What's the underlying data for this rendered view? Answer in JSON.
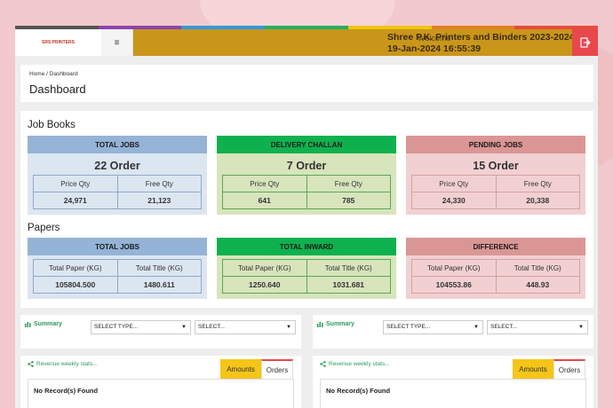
{
  "topbar": {
    "logo_text": "SRS PRINTERS",
    "menu_icon": "hamburger-icon",
    "welcome": "Welcome",
    "company": "Shree P.K. Printers and Binders 2023-2024",
    "datetime": "19-Jan-2024 16:55:39",
    "logout_icon": "logout-icon",
    "color_strip": [
      "#555555",
      "#8e44ad",
      "#3498db",
      "#27ae60",
      "#f1c40f",
      "#e67e22",
      "#e74c3c"
    ]
  },
  "breadcrumb": "Home / Dashboard",
  "page_title": "Dashboard",
  "job_books": {
    "title": "Job Books",
    "cards": [
      {
        "header": "TOTAL JOBS",
        "order": "22 Order",
        "col1": "Price Qty",
        "col2": "Free Qty",
        "val1": "24,971",
        "val2": "21,123"
      },
      {
        "header": "DELIVERY CHALLAN",
        "order": "7 Order",
        "col1": "Price Qty",
        "col2": "Free Qty",
        "val1": "641",
        "val2": "785"
      },
      {
        "header": "PENDING JOBS",
        "order": "15 Order",
        "col1": "Price Qty",
        "col2": "Free Qty",
        "val1": "24,330",
        "val2": "20,338"
      }
    ]
  },
  "papers": {
    "title": "Papers",
    "cards": [
      {
        "header": "TOTAL JOBS",
        "col1": "Total Paper (KG)",
        "col2": "Total Title (KG)",
        "val1": "105804.500",
        "val2": "1480.611"
      },
      {
        "header": "TOTAL INWARD",
        "col1": "Total Paper (KG)",
        "col2": "Total Title (KG)",
        "val1": "1250.640",
        "val2": "1031.681"
      },
      {
        "header": "DIFFERENCE",
        "col1": "Total Paper (KG)",
        "col2": "Total Title (KG)",
        "val1": "104553.86",
        "val2": "448.93"
      }
    ]
  },
  "summary": [
    {
      "label": "Summary",
      "icon": "bar-chart-icon",
      "select_type": "SELECT TYPE...",
      "select_other": "SELECT..."
    },
    {
      "label": "Summary",
      "icon": "bar-chart-icon",
      "select_type": "SELECT TYPE...",
      "select_other": "SELECT..."
    }
  ],
  "revenue": [
    {
      "label": "Revenue weekly stats...",
      "icon": "share-icon",
      "tab_amounts": "Amounts",
      "tab_orders": "Orders",
      "empty": "No Record(s) Found"
    },
    {
      "label": "Revenue weekly stats...",
      "icon": "share-icon",
      "tab_amounts": "Amounts",
      "tab_orders": "Orders",
      "empty": "No Record(s) Found"
    }
  ]
}
